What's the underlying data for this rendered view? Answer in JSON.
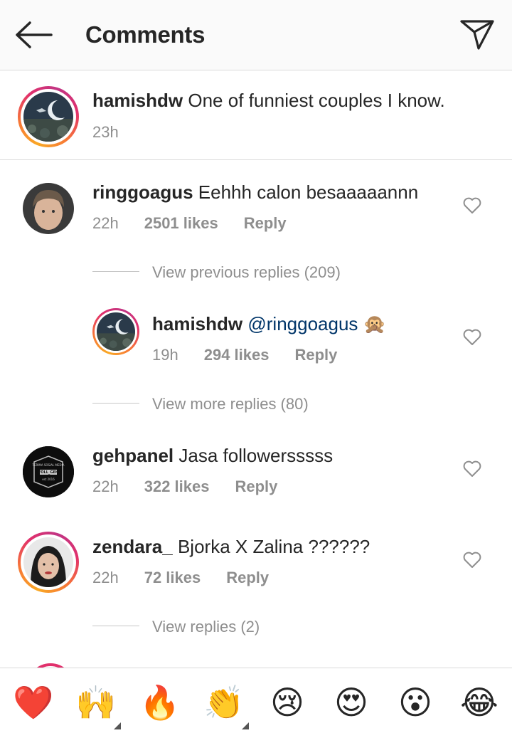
{
  "header": {
    "title": "Comments",
    "back_icon": "arrow-left-icon",
    "send_icon": "paper-plane-icon"
  },
  "caption": {
    "username": "hamishdw",
    "text": " One of funniest couples I know.",
    "time": "23h"
  },
  "comments": [
    {
      "username": "ringgoagus",
      "text": " Eehhh calon besaaaaannn",
      "time": "22h",
      "likes": "2501 likes",
      "reply": "Reply"
    },
    {
      "username": "gehpanel",
      "text": " Jasa followersssss",
      "time": "22h",
      "likes": "322 likes",
      "reply": "Reply"
    },
    {
      "username": "zendara_",
      "text": " Bjorka X Zalina ??????",
      "time": "22h",
      "likes": "72 likes",
      "reply": "Reply"
    }
  ],
  "view_previous": "View previous replies (209)",
  "nested_reply": {
    "username": "hamishdw",
    "mention": "@ringgoagus",
    "emoji": "🙊",
    "time": "19h",
    "likes": "294 likes",
    "reply": "Reply"
  },
  "view_more": "View more replies (80)",
  "view_replies": "View replies (2)",
  "gehpanel_badge": {
    "line1": "TERIMA SOSIAL MEDIA",
    "line2": "FOLL_GEH",
    "line3": "est 2016"
  },
  "emoji_bar": [
    "❤️",
    "🙌",
    "🔥",
    "👏",
    "😢",
    "😍",
    "😮",
    "😂"
  ],
  "colors": {
    "mention": "#003569",
    "secondary": "#8e8e8e",
    "ring": "#e1306c"
  }
}
